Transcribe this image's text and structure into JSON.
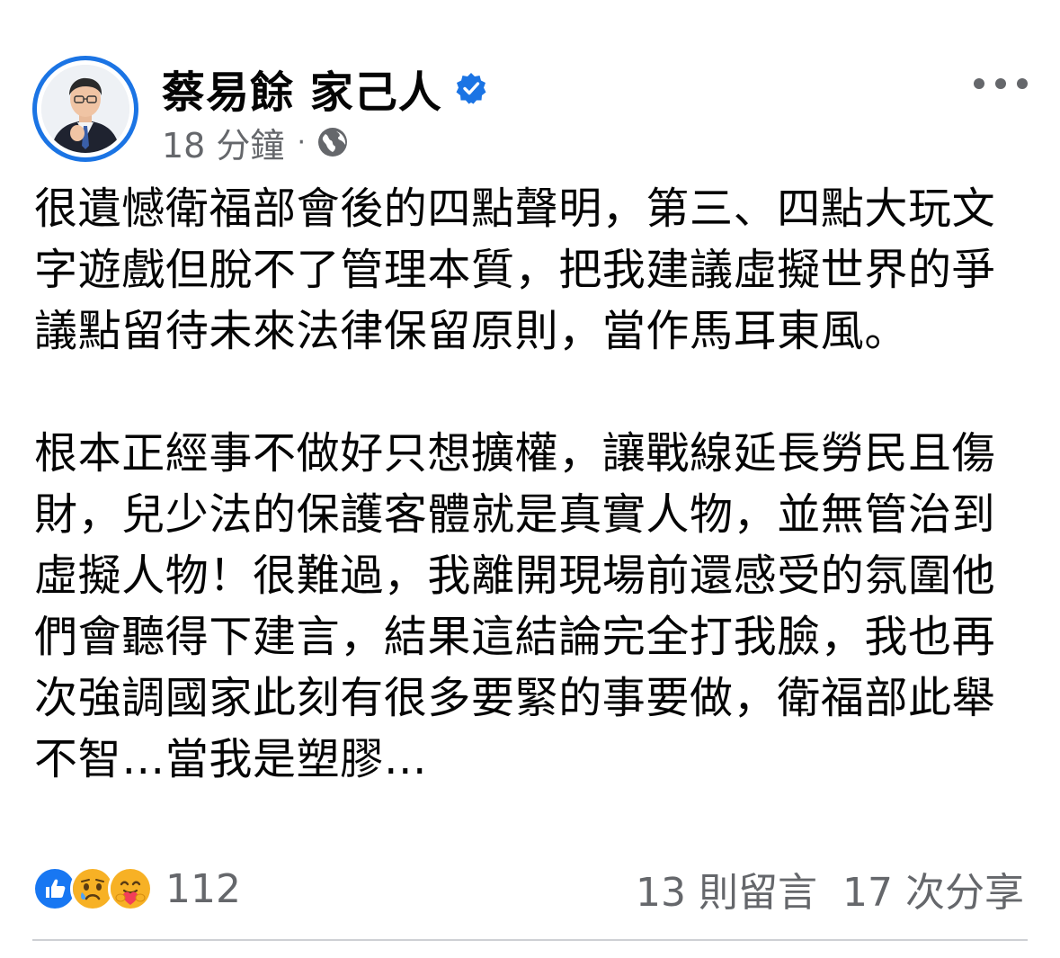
{
  "post": {
    "author_name": "蔡易餘 家己人",
    "timestamp": "18 分鐘",
    "separator": "·",
    "privacy_icon": "globe-icon",
    "verified_icon": "verified-badge-icon",
    "paragraphs": [
      "很遺憾衛福部會後的四點聲明，第三、四點大玩文字遊戲但脫不了管理本質，把我建議虛擬世界的爭議點留待未來法律保留原則，當作馬耳東風。",
      "根本正經事不做好只想擴權，讓戰線延長勞民且傷財，兒少法的保護客體就是真實人物，並無管治到虛擬人物！很難過，我離開現場前還感受的氛圍他們會聽得下建言，結果這結論完全打我臉，我也再次強調國家此刻有很多要緊的事要做，衛福部此舉不智…當我是塑膠…"
    ],
    "reactions": {
      "icons": [
        "like-icon",
        "sad-icon",
        "care-icon"
      ],
      "count": "112"
    },
    "comments_label": "13 則留言",
    "shares_label": "17 次分享"
  },
  "colors": {
    "accent": "#1b74e4",
    "secondary_text": "#65676b",
    "primary_text": "#050505",
    "divider": "#ced0d4"
  }
}
